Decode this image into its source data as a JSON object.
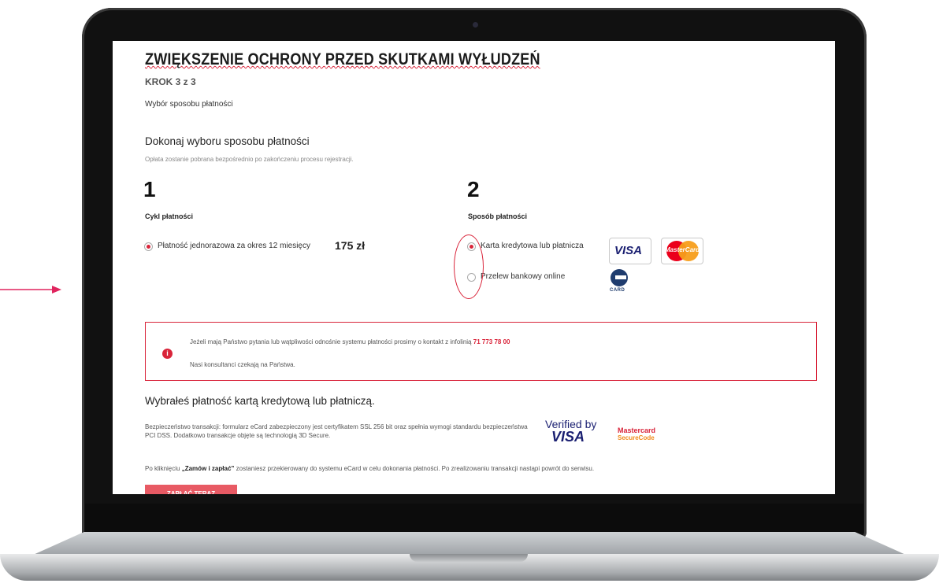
{
  "page": {
    "title": "ZWIĘKSZENIE OCHRONY PRZED SKUTKAMI WYŁUDZEŃ",
    "step": "KROK 3 z 3",
    "subtitle": "Wybór sposobu płatności",
    "heading": "Dokonaj wyboru sposobu płatności",
    "note": "Opłata zostanie pobrana bezpośrednio po zakończeniu procesu rejestracji."
  },
  "cycle": {
    "number": "1",
    "label": "Cykl płatności",
    "option": "Płatność jednorazowa za okres 12 miesięcy",
    "price": "175 zł"
  },
  "method": {
    "number": "2",
    "label": "Sposób płatności",
    "options": [
      {
        "label": "Karta kredytowa lub płatnicza",
        "selected": true
      },
      {
        "label": "Przelew bankowy online",
        "selected": false
      }
    ],
    "logos": {
      "visa": "VISA",
      "mastercard": "MasterCard",
      "ecard": "CARD"
    }
  },
  "info": {
    "line1_prefix": "Jeżeli mają Państwo pytania lub wątpliwości odnośnie systemu płatności prosimy o kontakt z infolinią",
    "phone": "71 773 78 00",
    "line2": "Nasi konsultanci czekają na Państwa."
  },
  "summary": {
    "chosen": "Wybrałeś płatność kartą kredytową lub płatniczą.",
    "security": "Bezpieczeństwo transakcji: formularz eCard zabezpieczony jest certyfikatem SSL 256 bit oraz spełnia wymogi standardu bezpieczeństwa PCI DSS. Dodatkowo transakcje objęte są technologią 3D Secure.",
    "verified_by": "Verified by",
    "verified_visa": "VISA",
    "mc_secure_1": "Mastercard",
    "mc_secure_2": "SecureCode",
    "redirect_prefix": "Po kliknięciu",
    "redirect_bold": "„Zamów i zapłać”",
    "redirect_suffix": "zostaniesz przekierowany do systemu eCard w celu dokonania płatności. Po zrealizowaniu transakcji nastąpi powrót do serwisu.",
    "button": "ZAPŁAĆ TERAZ"
  },
  "colors": {
    "accent": "#d9243a",
    "button": "#e85a64"
  }
}
